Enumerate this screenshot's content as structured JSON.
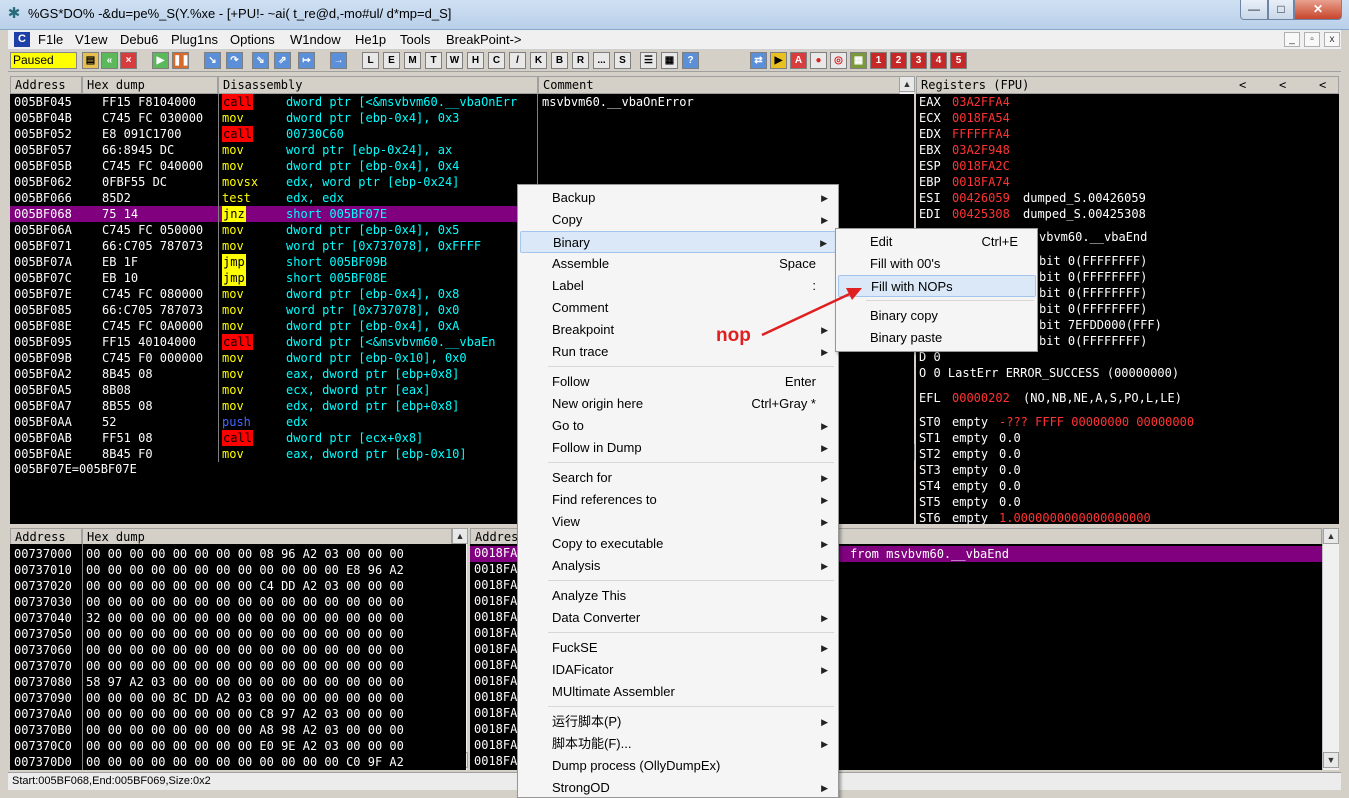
{
  "window": {
    "title": "%GS*DO% -&du=pe%_S(Y.%xe - [+PU!- ~ai( t_re@d,-mo#ul/ d*mp=d_S]",
    "btn_min": "—",
    "btn_max": "□",
    "btn_close": "✕"
  },
  "menu": {
    "logo": "C",
    "items": [
      "F1le",
      "V1ew",
      "Debu6",
      "Plug1ns",
      "Options",
      "W1ndow",
      "He1p",
      "Tools",
      "BreakPoint->"
    ],
    "mdi_min": "_",
    "mdi_restore": "▫",
    "mdi_close": "x"
  },
  "toolbar": {
    "status": "Paused",
    "letter_buttons": [
      "L",
      "E",
      "M",
      "T",
      "W",
      "H",
      "C",
      "/",
      "K",
      "B",
      "R",
      "...",
      "S"
    ],
    "number_buttons": [
      "1",
      "2",
      "3",
      "4",
      "5"
    ],
    "ctrl_buttons": [
      "⇄",
      "▶",
      "A",
      "●",
      "◎",
      "▦"
    ]
  },
  "cpu": {
    "headers": {
      "address": "Address",
      "hex": "Hex dump",
      "disasm": "Disassembly",
      "comment": "Comment"
    },
    "rows": [
      {
        "addr": "005BF045",
        "hex": "FF15 F8104000",
        "mn": "call",
        "op": "dword ptr [<&msvbvm60.__vbaOnErr",
        "cm": "msvbvm60.__vbaOnError"
      },
      {
        "addr": "005BF04B",
        "hex": "C745 FC 030000",
        "mn": "mov",
        "op": "dword ptr [ebp-0x4], 0x3",
        "cm": ""
      },
      {
        "addr": "005BF052",
        "hex": "E8 091C1700",
        "mn": "call",
        "op": "00730C60",
        "cm": ""
      },
      {
        "addr": "005BF057",
        "hex": "66:8945 DC",
        "mn": "mov",
        "op": "word ptr [ebp-0x24], ax",
        "cm": ""
      },
      {
        "addr": "005BF05B",
        "hex": "C745 FC 040000",
        "mn": "mov",
        "op": "dword ptr [ebp-0x4], 0x4",
        "cm": ""
      },
      {
        "addr": "005BF062",
        "hex": "0FBF55 DC",
        "mn": "movsx",
        "op": "edx, word ptr [ebp-0x24]",
        "cm": ""
      },
      {
        "addr": "005BF066",
        "hex": "85D2",
        "mn": "test",
        "op": "edx, edx",
        "cm": ""
      },
      {
        "addr": "005BF068",
        "hex": "75 14",
        "mn": "jnz",
        "op": "short 005BF07E",
        "cm": ""
      },
      {
        "addr": "005BF06A",
        "hex": "C745 FC 050000",
        "mn": "mov",
        "op": "dword ptr [ebp-0x4], 0x5",
        "cm": ""
      },
      {
        "addr": "005BF071",
        "hex": "66:C705 787073",
        "mn": "mov",
        "op": "word ptr [0x737078], 0xFFFF",
        "cm": ""
      },
      {
        "addr": "005BF07A",
        "hex": "EB 1F",
        "mn": "jmp",
        "op": "short 005BF09B",
        "cm": ""
      },
      {
        "addr": "005BF07C",
        "hex": "EB 10",
        "mn": "jmp",
        "op": "short 005BF08E",
        "cm": ""
      },
      {
        "addr": "005BF07E",
        "hex": "C745 FC 080000",
        "mn": "mov",
        "op": "dword ptr [ebp-0x4], 0x8",
        "cm": ""
      },
      {
        "addr": "005BF085",
        "hex": "66:C705 787073",
        "mn": "mov",
        "op": "word ptr [0x737078], 0x0",
        "cm": ""
      },
      {
        "addr": "005BF08E",
        "hex": "C745 FC 0A0000",
        "mn": "mov",
        "op": "dword ptr [ebp-0x4], 0xA",
        "cm": ""
      },
      {
        "addr": "005BF095",
        "hex": "FF15 40104000",
        "mn": "call",
        "op": "dword ptr [<&msvbvm60.__vbaEn",
        "cm": ""
      },
      {
        "addr": "005BF09B",
        "hex": "C745 F0 000000",
        "mn": "mov",
        "op": "dword ptr [ebp-0x10], 0x0",
        "cm": ""
      },
      {
        "addr": "005BF0A2",
        "hex": "8B45 08",
        "mn": "mov",
        "op": "eax, dword ptr [ebp+0x8]",
        "cm": ""
      },
      {
        "addr": "005BF0A5",
        "hex": "8B08",
        "mn": "mov",
        "op": "ecx, dword ptr [eax]",
        "cm": ""
      },
      {
        "addr": "005BF0A7",
        "hex": "8B55 08",
        "mn": "mov",
        "op": "edx, dword ptr [ebp+0x8]",
        "cm": ""
      },
      {
        "addr": "005BF0AA",
        "hex": "52",
        "mn": "push",
        "op": "edx",
        "cm": ""
      },
      {
        "addr": "005BF0AB",
        "hex": "FF51 08",
        "mn": "call",
        "op": "dword ptr [ecx+0x8]",
        "cm": ""
      },
      {
        "addr": "005BF0AE",
        "hex": "8B45 F0",
        "mn": "mov",
        "op": "eax, dword ptr [ebp-0x10]",
        "cm": ""
      }
    ],
    "info_line": "005BF07E=005BF07E"
  },
  "registers": {
    "header": "Registers (FPU)",
    "nav": [
      "<",
      "<",
      "<"
    ],
    "lines": [
      {
        "name": "EAX",
        "val": "03A2FFA4",
        "rest": ""
      },
      {
        "name": "ECX",
        "val": "0018FA54",
        "rest": ""
      },
      {
        "name": "EDX",
        "val": "FFFFFFA4",
        "rest": ""
      },
      {
        "name": "EBX",
        "val": "03A2F948",
        "rest": ""
      },
      {
        "name": "ESP",
        "val": "0018FA2C",
        "rest": ""
      },
      {
        "name": "EBP",
        "val": "0018FA74",
        "rest": ""
      },
      {
        "name": "ESI",
        "val": "00426059",
        "rest": "dumped_S.00426059"
      },
      {
        "name": "EDI",
        "val": "00425308",
        "rest": "dumped_S.00425308"
      }
    ],
    "eip_tail": "vbvm60.__vbaEnd",
    "seg_tails": [
      "bit 0(FFFFFFFF)",
      "bit 0(FFFFFFFF)",
      "bit 0(FFFFFFFF)",
      "bit 0(FFFFFFFF)",
      "bit 7EFDD000(FFF)",
      "bit 0(FFFFFFFF)"
    ],
    "flag_d": "D 0",
    "flag_o": "O 0  LastErr ERROR_SUCCESS (00000000)",
    "efl_name": "EFL",
    "efl_val": "00000202",
    "efl_rest": "(NO,NB,NE,A,S,PO,L,LE)",
    "fpu": [
      {
        "name": "ST0",
        "state": "empty",
        "val": "-??? FFFF 00000000 00000000",
        "hl": true
      },
      {
        "name": "ST1",
        "state": "empty",
        "val": "0.0",
        "hl": false
      },
      {
        "name": "ST2",
        "state": "empty",
        "val": "0.0",
        "hl": false
      },
      {
        "name": "ST3",
        "state": "empty",
        "val": "0.0",
        "hl": false
      },
      {
        "name": "ST4",
        "state": "empty",
        "val": "0.0",
        "hl": false
      },
      {
        "name": "ST5",
        "state": "empty",
        "val": "0.0",
        "hl": false
      },
      {
        "name": "ST6",
        "state": "empty",
        "val": "1.0000000000000000000",
        "hl": true
      }
    ]
  },
  "dump": {
    "headers": {
      "address": "Address",
      "hex": "Hex dump"
    },
    "rows": [
      {
        "addr": "00737000",
        "hex": "00 00 00 00 00 00 00 00 08 96 A2 03 00 00 00"
      },
      {
        "addr": "00737010",
        "hex": "00 00 00 00 00 00 00 00 00 00 00 00 E8 96 A2"
      },
      {
        "addr": "00737020",
        "hex": "00 00 00 00 00 00 00 00 C4 DD A2 03 00 00 00"
      },
      {
        "addr": "00737030",
        "hex": "00 00 00 00 00 00 00 00 00 00 00 00 00 00 00"
      },
      {
        "addr": "00737040",
        "hex": "32 00 00 00 00 00 00 00 00 00 00 00 00 00 00"
      },
      {
        "addr": "00737050",
        "hex": "00 00 00 00 00 00 00 00 00 00 00 00 00 00 00"
      },
      {
        "addr": "00737060",
        "hex": "00 00 00 00 00 00 00 00 00 00 00 00 00 00 00"
      },
      {
        "addr": "00737070",
        "hex": "00 00 00 00 00 00 00 00 00 00 00 00 00 00 00"
      },
      {
        "addr": "00737080",
        "hex": "58 97 A2 03 00 00 00 00 00 00 00 00 00 00 00"
      },
      {
        "addr": "00737090",
        "hex": "00 00 00 00 8C DD A2 03 00 00 00 00 00 00 00"
      },
      {
        "addr": "007370A0",
        "hex": "00 00 00 00 00 00 00 00 C8 97 A2 03 00 00 00"
      },
      {
        "addr": "007370B0",
        "hex": "00 00 00 00 00 00 00 00 A8 98 A2 03 00 00 00"
      },
      {
        "addr": "007370C0",
        "hex": "00 00 00 00 00 00 00 00 E0 9E A2 03 00 00 00"
      },
      {
        "addr": "007370D0",
        "hex": "00 00 00 00 00 00 00 00 00 00 00 00 C0 9F A2"
      }
    ]
  },
  "stack": {
    "header": "Addres",
    "rows": [
      "0018FA",
      "0018FA",
      "0018FA",
      "0018FA",
      "0018FA",
      "0018FA",
      "0018FA",
      "0018FA",
      "0018FA",
      "0018FA",
      "0018FA",
      "0018FA",
      "0018FA",
      "0018FA"
    ],
    "sel_comment": "from msvbvm60.__vbaEnd"
  },
  "statusbar": "Start:005BF068,End:005BF069,Size:0x2",
  "context_menu": {
    "items": [
      {
        "label": "Backup",
        "shortcut": "",
        "sub": true
      },
      {
        "label": "Copy",
        "shortcut": "",
        "sub": true
      },
      {
        "label": "Binary",
        "shortcut": "",
        "sub": true
      },
      {
        "label": "Assemble",
        "shortcut": "Space",
        "sub": false
      },
      {
        "label": "Label",
        "shortcut": ":",
        "sub": false
      },
      {
        "label": "Comment",
        "shortcut": "",
        "sub": false
      },
      {
        "label": "Breakpoint",
        "shortcut": "",
        "sub": true
      },
      {
        "label": "Run trace",
        "shortcut": "",
        "sub": true
      },
      {
        "label": "Follow",
        "shortcut": "Enter",
        "sub": false
      },
      {
        "label": "New origin here",
        "shortcut": "Ctrl+Gray *",
        "sub": false
      },
      {
        "label": "Go to",
        "shortcut": "",
        "sub": true
      },
      {
        "label": "Follow in Dump",
        "shortcut": "",
        "sub": true
      },
      {
        "label": "Search for",
        "shortcut": "",
        "sub": true
      },
      {
        "label": "Find references to",
        "shortcut": "",
        "sub": true
      },
      {
        "label": "View",
        "shortcut": "",
        "sub": true
      },
      {
        "label": "Copy to executable",
        "shortcut": "",
        "sub": true
      },
      {
        "label": "Analysis",
        "shortcut": "",
        "sub": true
      },
      {
        "label": "Analyze This",
        "shortcut": "",
        "sub": false
      },
      {
        "label": "Data Converter",
        "shortcut": "",
        "sub": true
      },
      {
        "label": "FuckSE",
        "shortcut": "",
        "sub": true
      },
      {
        "label": "IDAFicator",
        "shortcut": "",
        "sub": true
      },
      {
        "label": "MUltimate Assembler",
        "shortcut": "",
        "sub": false
      },
      {
        "label": "运行脚本(P)",
        "shortcut": "",
        "sub": true
      },
      {
        "label": "脚本功能(F)...",
        "shortcut": "",
        "sub": true
      },
      {
        "label": "Dump process (OllyDumpEx)",
        "shortcut": "",
        "sub": false
      },
      {
        "label": "StrongOD",
        "shortcut": "",
        "sub": true
      }
    ],
    "submenu": [
      {
        "label": "Edit",
        "shortcut": "Ctrl+E"
      },
      {
        "label": "Fill with 00's",
        "shortcut": ""
      },
      {
        "label": "Fill with NOPs",
        "shortcut": ""
      },
      {
        "label": "Binary copy",
        "shortcut": ""
      },
      {
        "label": "Binary paste",
        "shortcut": ""
      }
    ]
  },
  "annotation": {
    "text": "nop",
    "color": "#e02020"
  }
}
